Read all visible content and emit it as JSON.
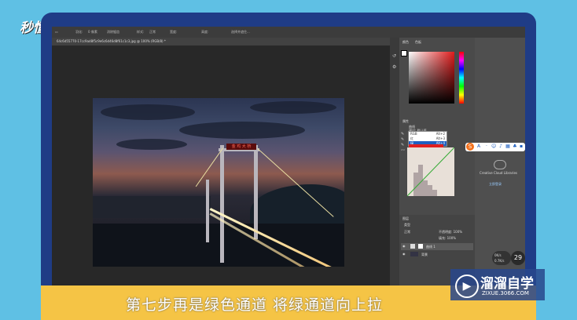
{
  "logo": {
    "text": "秒懂视频"
  },
  "photoshop": {
    "options_bar": {
      "items": [
        "羽化:",
        "0 像素",
        "消除锯齿",
        "样式:",
        "正常",
        "宽度:",
        "高度:",
        "选择并遮住..."
      ]
    },
    "document_tab": {
      "label": "64c6d55770-17cc9ad8f5c9e6c6d46d8f61c1c3.jpg @ 100% (RGB/8) *"
    },
    "sign_text": "金 鸡 大 桥",
    "panels": {
      "color_title": "颜色",
      "swatches_title": "色板",
      "properties_title": "属性",
      "curves_label": "曲线",
      "preset_label": "预设: 默认值",
      "dropdown": {
        "options": [
          "RGB",
          "红",
          "绿",
          "蓝"
        ],
        "selected": "绿",
        "shortcuts": [
          "Alt+2",
          "Alt+3",
          "Alt+4",
          "Alt+5"
        ]
      },
      "layers_title": "图层",
      "kind_label": "类型",
      "blend_mode": "正常",
      "opacity_label": "不透明度: 100%",
      "fill_label": "填充: 100%",
      "layers": [
        {
          "name": "曲线 1"
        },
        {
          "name": "背景"
        }
      ],
      "libraries_hint": "Creative Cloud Libraries",
      "libraries_link": "立即登录"
    }
  },
  "system": {
    "badge_number": "29",
    "net_up": "0K/s",
    "net_down": "0.7K/s"
  },
  "subtitle": {
    "text": "第七步再是绿色通道 将绿通道向上拉"
  },
  "brand": {
    "name": "溜溜自学",
    "url": "ZIXUE.3066.COM"
  },
  "colors": {
    "background": "#5fc0e4",
    "frame": "#1f3c86",
    "subtitle_bar": "#f5c445",
    "accent_blue": "#1f5fc0"
  }
}
